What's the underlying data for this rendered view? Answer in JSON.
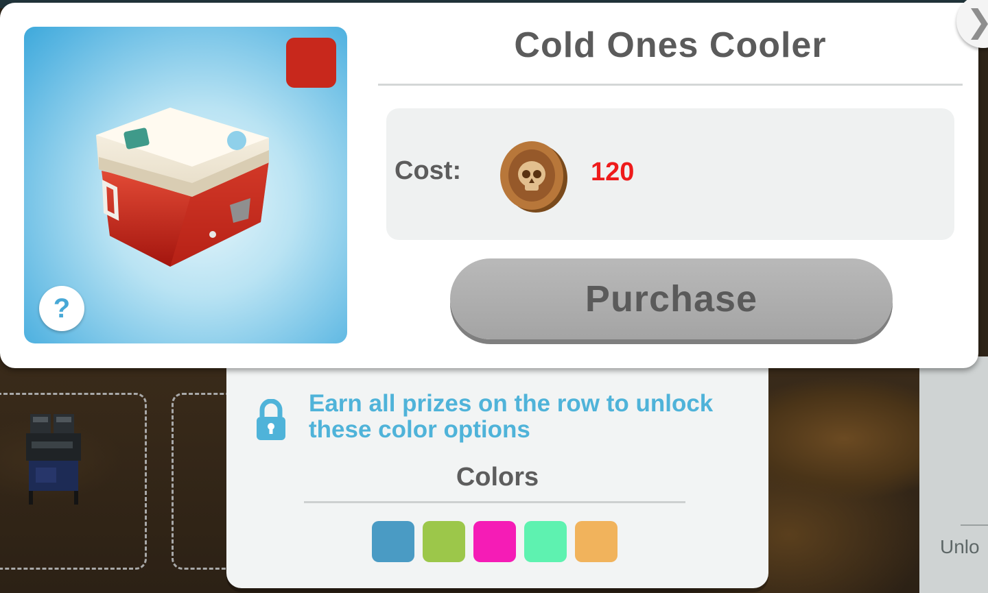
{
  "item": {
    "title": "Cold Ones Cooler",
    "selected_color": "#c8281c",
    "help_label": "?"
  },
  "cost": {
    "label": "Cost:",
    "currency_icon": "skull-coin-icon",
    "value": "120",
    "value_color": "#ee1b1b"
  },
  "purchase": {
    "label": "Purchase",
    "enabled": false
  },
  "close": {
    "label": "❯"
  },
  "colors": {
    "locked_message": "Earn all prizes on the row to unlock these color options",
    "title": "Colors",
    "options": [
      "#4a9bc4",
      "#9cc74a",
      "#f51cb6",
      "#5ef2b0",
      "#f1b35c"
    ]
  },
  "background": {
    "partial_label": "Unlo"
  }
}
